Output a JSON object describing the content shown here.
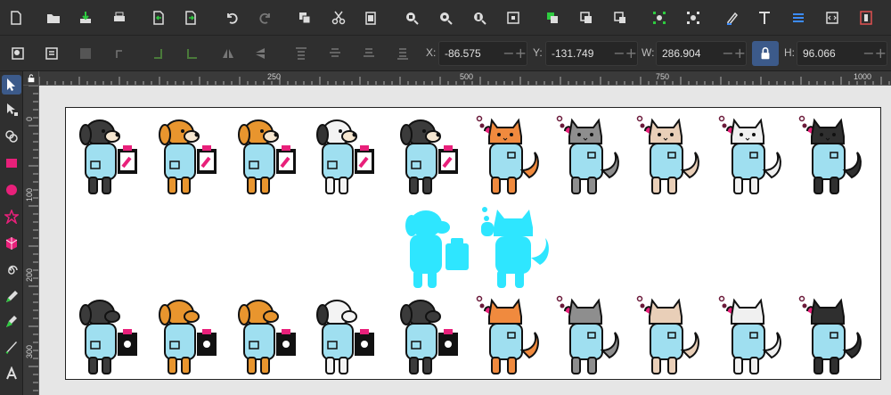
{
  "toolbar": {
    "commands": [
      {
        "name": "new-document-icon"
      },
      {
        "name": "open-icon"
      },
      {
        "name": "save-icon"
      },
      {
        "name": "print-icon"
      },
      {
        "name": "import-icon"
      },
      {
        "name": "export-icon"
      },
      {
        "name": "undo-icon"
      },
      {
        "name": "redo-icon"
      },
      {
        "name": "copy-icon"
      },
      {
        "name": "cut-icon"
      },
      {
        "name": "paste-icon"
      },
      {
        "name": "zoom-selection-icon"
      },
      {
        "name": "zoom-drawing-icon"
      },
      {
        "name": "zoom-page-icon"
      },
      {
        "name": "zoom-fit-icon"
      },
      {
        "name": "duplicate-icon"
      },
      {
        "name": "clone-icon"
      },
      {
        "name": "unlink-clone-icon"
      },
      {
        "name": "group-icon"
      },
      {
        "name": "ungroup-icon"
      },
      {
        "name": "fill-stroke-icon"
      },
      {
        "name": "text-icon"
      },
      {
        "name": "layers-icon"
      },
      {
        "name": "xml-editor-icon"
      },
      {
        "name": "document-properties-icon"
      }
    ]
  },
  "controls": {
    "x_label": "X:",
    "x_value": "-86.575",
    "y_label": "Y:",
    "y_value": "-131.749",
    "w_label": "W:",
    "w_value": "286.904",
    "h_label": "H:",
    "h_value": "96.066",
    "minus": "−",
    "plus": "+"
  },
  "ruler": {
    "top_labels": [
      "250",
      "500",
      "750",
      "1000"
    ],
    "left_labels": [
      "0",
      "100",
      "200",
      "300"
    ]
  },
  "colors": {
    "accent": "#3c5a8a",
    "coat": "#9fdff0",
    "silhouette": "#2ee6ff",
    "pink": "#e8207a"
  },
  "characters": {
    "dogs": [
      "#3b3b3b",
      "#e8952e",
      "#e8952e",
      "#f3f3f3",
      "#3b3b3b"
    ],
    "cats": [
      "#f08a3e",
      "#8e8e8e",
      "#e9cfb8",
      "#f0f0f0",
      "#2f2f2f"
    ]
  }
}
